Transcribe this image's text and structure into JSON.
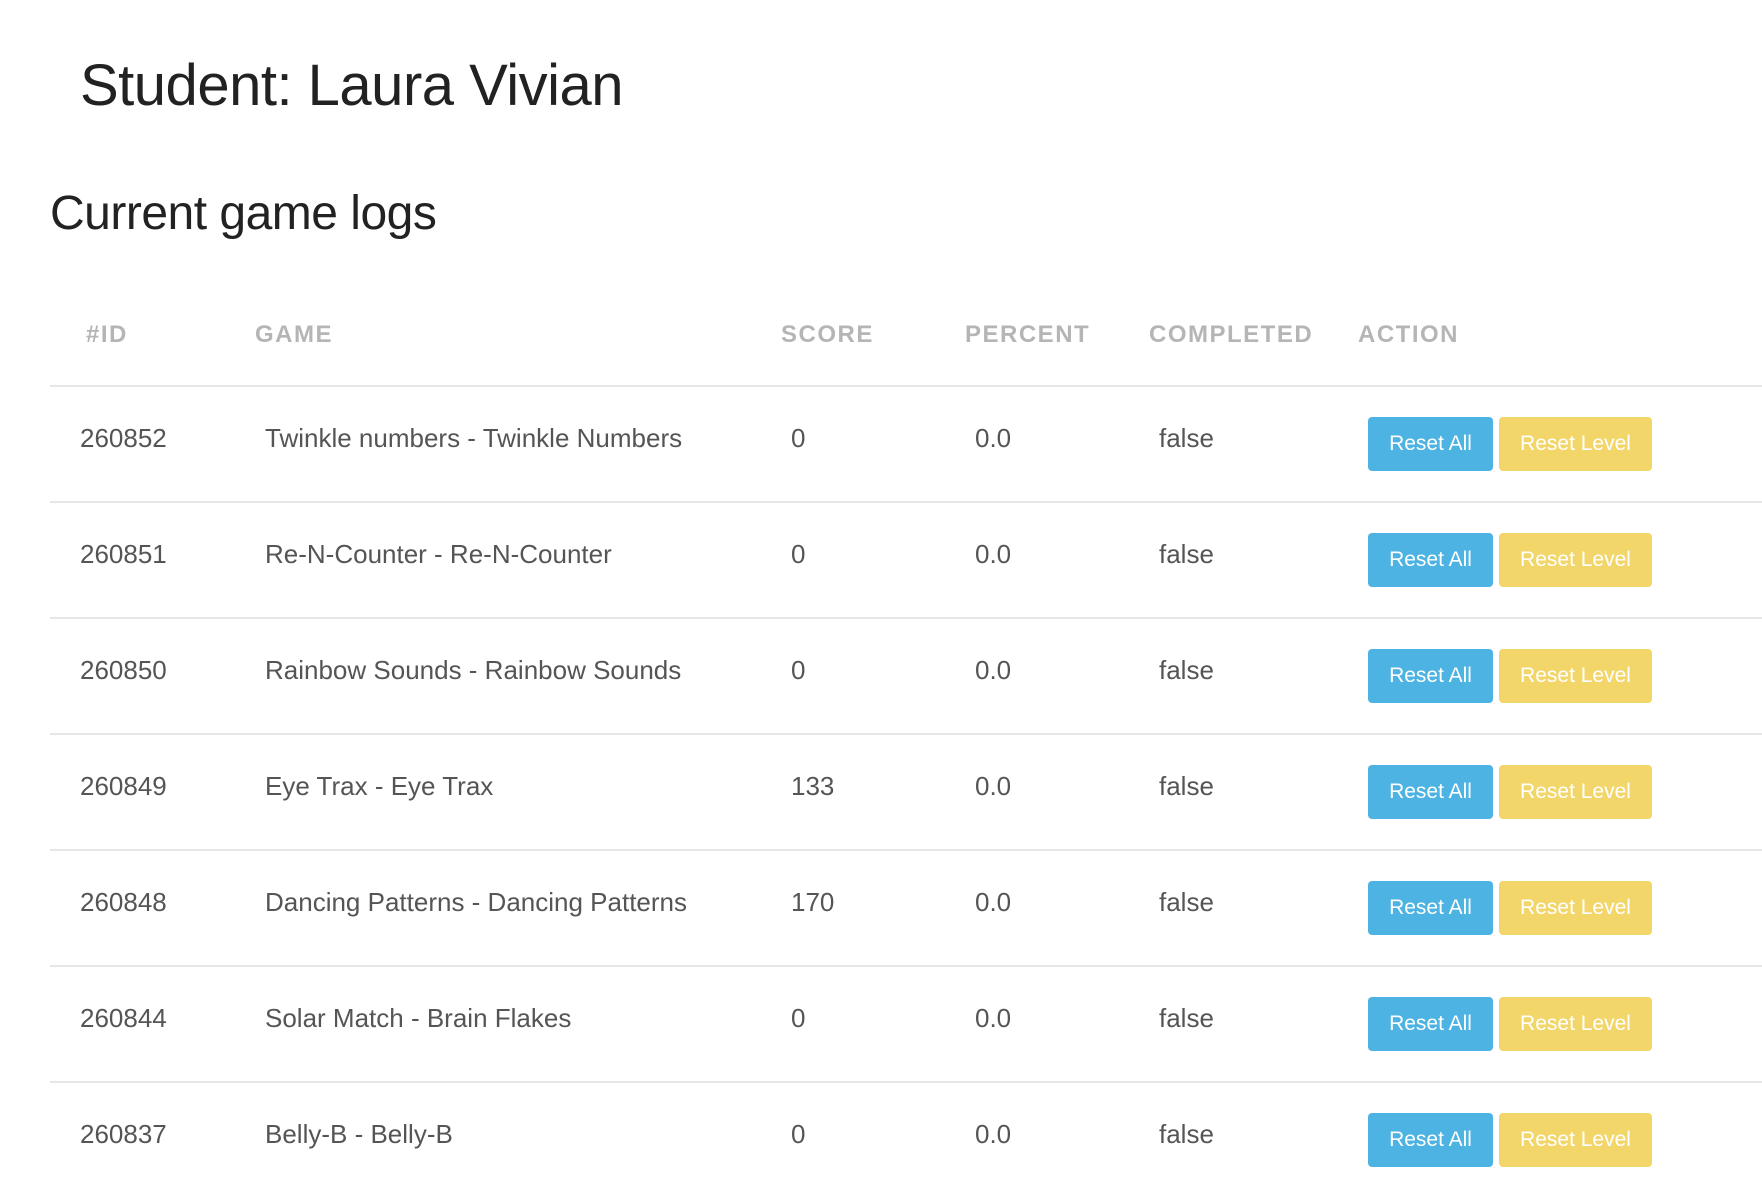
{
  "page": {
    "student_title": "Student: Laura Vivian",
    "section_title": "Current game logs"
  },
  "table": {
    "columns": [
      "#ID",
      "GAME",
      "SCORE",
      "PERCENT",
      "COMPLETED",
      "ACTION"
    ],
    "rows": [
      {
        "id": "260852",
        "game": "Twinkle numbers - Twinkle Numbers",
        "score": "0",
        "percent": "0.0",
        "completed": "false"
      },
      {
        "id": "260851",
        "game": "Re-N-Counter - Re-N-Counter",
        "score": "0",
        "percent": "0.0",
        "completed": "false"
      },
      {
        "id": "260850",
        "game": "Rainbow Sounds - Rainbow Sounds",
        "score": "0",
        "percent": "0.0",
        "completed": "false"
      },
      {
        "id": "260849",
        "game": "Eye Trax - Eye Trax",
        "score": "133",
        "percent": "0.0",
        "completed": "false"
      },
      {
        "id": "260848",
        "game": "Dancing Patterns - Dancing Patterns",
        "score": "170",
        "percent": "0.0",
        "completed": "false"
      },
      {
        "id": "260844",
        "game": "Solar Match - Brain Flakes",
        "score": "0",
        "percent": "0.0",
        "completed": "false"
      },
      {
        "id": "260837",
        "game": "Belly-B - Belly-B",
        "score": "0",
        "percent": "0.0",
        "completed": "false"
      }
    ],
    "actions": {
      "reset_all_label": "Reset All",
      "reset_level_label": "Reset Level"
    }
  },
  "colors": {
    "reset_all_bg": "#4db3e2",
    "reset_level_bg": "#f3d66a",
    "header_text": "#b5b5b5",
    "body_text": "#555555"
  }
}
